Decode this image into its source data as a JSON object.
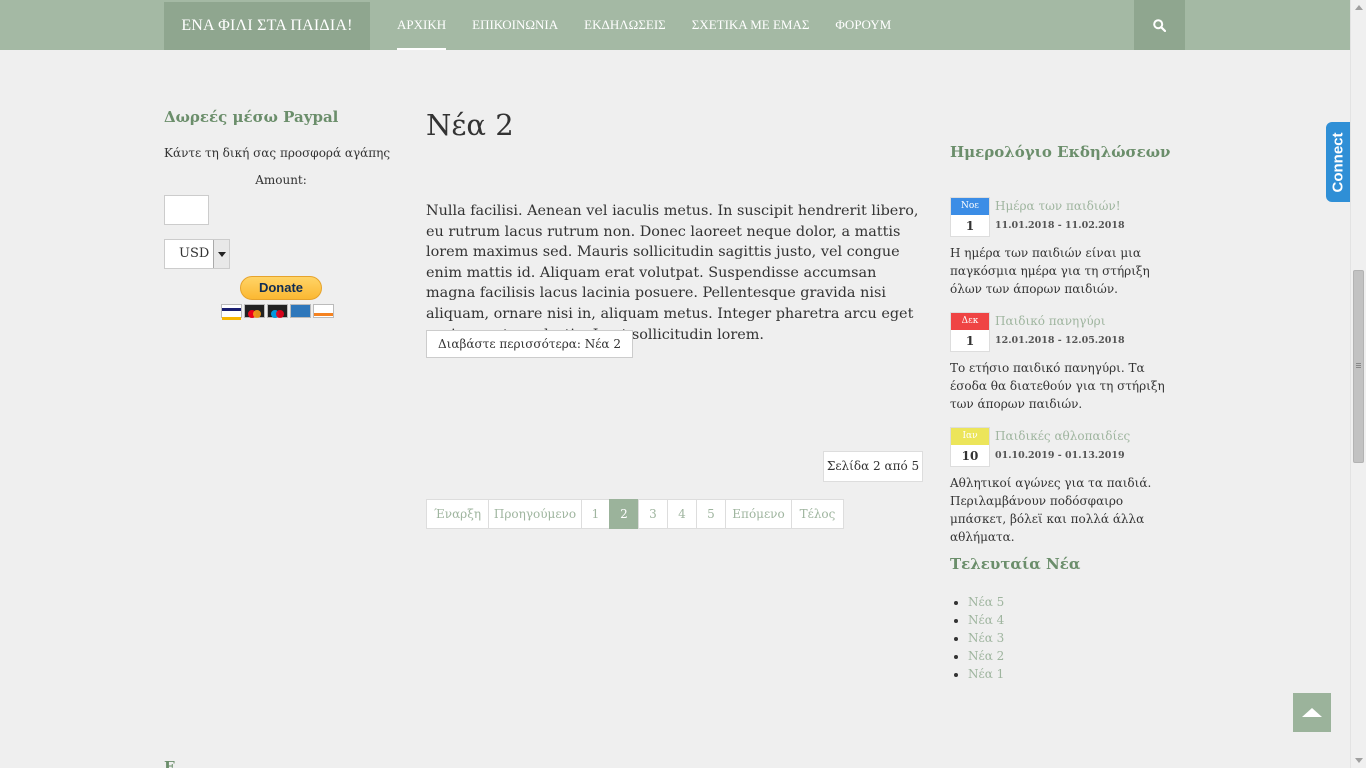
{
  "header": {
    "brand": "ΕΝΑ ΦΙΛΙ ΣΤΑ ΠΑΙΔΙΑ!",
    "nav": [
      {
        "label": "ΑΡΧΙΚΗ",
        "active": true
      },
      {
        "label": "ΕΠΙΚΟΙΝΩΝΙΑ",
        "active": false
      },
      {
        "label": "ΕΚΔΗΛΩΣΕΙΣ",
        "active": false
      },
      {
        "label": "ΣΧΕΤΙΚΑ ΜΕ ΕΜΑΣ",
        "active": false
      },
      {
        "label": "ΦΟΡΟΥΜ",
        "active": false
      }
    ],
    "search_icon": "search-icon"
  },
  "connect_tab": "Connect",
  "paypal": {
    "title": "Δωρεές μέσω Paypal",
    "text": "Κάντε τη δική σας προσφορά αγάπης",
    "amount_label": "Amount:",
    "amount_value": "",
    "currency": "USD",
    "donate_label": "Donate",
    "cards": [
      "visa",
      "mastercard",
      "maestro",
      "amex",
      "discover"
    ]
  },
  "main": {
    "title": "Νέα 2",
    "body": "Nulla facilisi. Aenean vel iaculis metus. In suscipit hendrerit libero, eu rutrum lacus rutrum non. Donec laoreet neque dolor, a mattis lorem maximus sed. Mauris sollicitudin sagittis justo, vel congue enim mattis id. Aliquam erat volutpat. Suspendisse accumsan magna facilisis lacus lacinia posuere. Pellentesque gravida nisi aliquam, ornare nisi in, aliquam metus. Integer pharetra arcu eget sapien porta molestie. In ut sollicitudin lorem.",
    "read_more": "Διαβάστε περισσότερα: Νέα 2",
    "page_count": "Σελίδα 2 από 5",
    "pagination": [
      "Έναρξη",
      "Προηγούμενο",
      "1",
      "2",
      "3",
      "4",
      "5",
      "Επόμενο",
      "Τέλος"
    ],
    "current_page": "2"
  },
  "events": {
    "title": "Ημερολόγιο Εκδηλώσεων",
    "items": [
      {
        "month": "Νοε",
        "day": "1",
        "color": "#3b8de6",
        "title": "Ημέρα των παιδιών!",
        "dates": "11.01.2018 - 11.02.2018",
        "desc": "Η ημέρα των παιδιών είναι μια παγκόσμια ημέρα για τη στήριξη όλων των άπορων παιδιών."
      },
      {
        "month": "Δεκ",
        "day": "1",
        "color": "#ef4444",
        "title": "Παιδικό πανηγύρι",
        "dates": "12.01.2018 - 12.05.2018",
        "desc": "Το ετήσιο παιδικό πανηγύρι. Τα έσοδα θα διατεθούν για τη στήριξη των άπορων παιδιών."
      },
      {
        "month": "Ιαν",
        "day": "10",
        "color": "#ece55a",
        "title": "Παιδικές αθλοπαιδίες",
        "dates": "01.10.2019 - 01.13.2019",
        "desc": "Αθλητικοί αγώνες για τα παιδιά. Περιλαμβάνουν ποδόσφαιρο μπάσκετ, βόλεϊ και πολλά άλλα αθλήματα."
      }
    ]
  },
  "latest_news": {
    "title": "Τελευταία Νέα",
    "items": [
      "Νέα 5",
      "Νέα 4",
      "Νέα 3",
      "Νέα 2",
      "Νέα 1"
    ]
  },
  "footer_cutoff": "Ε... ...."
}
